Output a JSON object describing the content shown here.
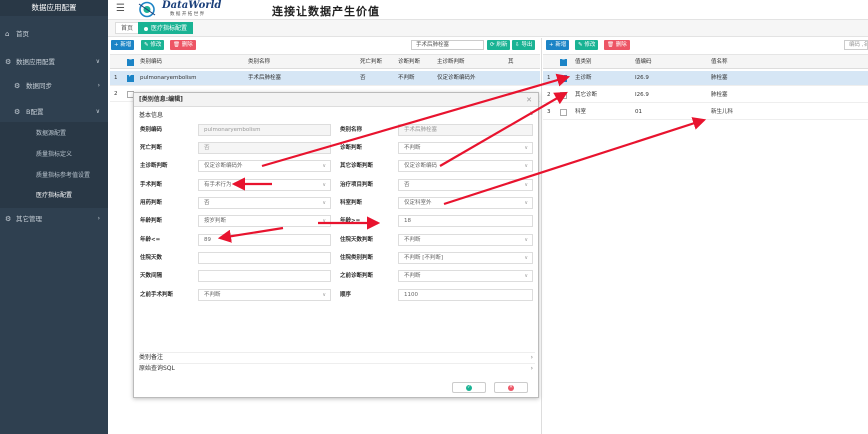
{
  "sidebar": {
    "title": "数据应用配置",
    "items": [
      {
        "label": "首页"
      },
      {
        "label": "数据应用配置"
      },
      {
        "label": "数据同步"
      },
      {
        "label": "B配置"
      },
      {
        "label": "其它管理"
      }
    ],
    "subitems": [
      {
        "label": "数据源配置"
      },
      {
        "label": "质量指标定义"
      },
      {
        "label": "质量指标参考值设置"
      },
      {
        "label": "医疗指标配置"
      }
    ]
  },
  "header": {
    "logo_text": "DataWorld",
    "logo_sub": "数 据 开 拓 世 界",
    "slogan": "连接让数据产生价值"
  },
  "tabs": [
    {
      "label": "首页"
    },
    {
      "label": "医疗指标配置"
    }
  ],
  "left_toolbar": {
    "add": "+ 新增",
    "edit": "✎ 修改",
    "delete": "🗑 删除",
    "search_value": "手术后肺栓塞",
    "refresh": "⟳ 刷新",
    "export": "⇩ 导出"
  },
  "left_table": {
    "headers": [
      "类别编码",
      "类别名称",
      "死亡判断",
      "诊断判断",
      "主诊断判断",
      "其"
    ],
    "rows": [
      {
        "num": "1",
        "code": "pulmonaryembolism",
        "name": "手术后肺栓塞",
        "death": "否",
        "diag": "不判断",
        "main": "仅定诊断编码外"
      },
      {
        "num": "2",
        "code": "",
        "name": "",
        "death": "",
        "diag": "",
        "main": ""
      }
    ]
  },
  "right_toolbar": {
    "add": "+ 新增",
    "edit": "✎ 修改",
    "delete": "🗑 删除",
    "search_value": "编码 ,名"
  },
  "right_table": {
    "headers": [
      "值类别",
      "值编码",
      "值名称"
    ],
    "rows": [
      {
        "num": "1",
        "type": "主诊断",
        "code": "I26.9",
        "name": "肺栓塞"
      },
      {
        "num": "2",
        "type": "其它诊断",
        "code": "I26.9",
        "name": "肺栓塞"
      },
      {
        "num": "3",
        "type": "科室",
        "code": "01",
        "name": "新生儿科"
      }
    ]
  },
  "modal": {
    "title": "[类别信息:编辑]",
    "section": "基本信息",
    "fields": {
      "code_label": "类别编码",
      "code_value": "pulmonaryembolism",
      "name_label": "类别名称",
      "name_value": "手术后肺栓塞",
      "death_label": "死亡判断",
      "death_value": "否",
      "diag_label": "诊断判断",
      "diag_value": "不判断",
      "main_diag_label": "主诊断判断",
      "main_diag_value": "仅定诊断编码外",
      "other_diag_label": "其它诊断判断",
      "other_diag_value": "仅定诊断编码",
      "surgery_label": "手术判断",
      "surgery_value": "有手术行为",
      "treat_label": "治疗项目判断",
      "treat_value": "否",
      "drug_label": "用药判断",
      "drug_value": "否",
      "dept_label": "科室判断",
      "dept_value": "仅定科室外",
      "age_label": "年龄判断",
      "age_value": "按岁判断",
      "age_ge_label": "年龄>=",
      "age_ge_value": "18",
      "age_le_label": "年龄<=",
      "age_le_value": "89",
      "stay_label": "住院天数判断",
      "stay_value": "不判断",
      "stay_days_label": "住院天数",
      "stay_days_value": "",
      "stay_cat_label": "住院类别判断",
      "stay_cat_value": "不判断 [不判断]",
      "interval_label": "天数间隔",
      "interval_value": "",
      "prev_diag_label": "之前诊断判断",
      "prev_diag_value": "不判断",
      "prev_surg_label": "之前手术判断",
      "prev_surg_value": "不判断",
      "order_label": "顺序",
      "order_value": "1100"
    },
    "remark_label": "类别备注",
    "sql_label": "原始查询SQL"
  },
  "colors": {
    "sidebar": "#2f4050",
    "accent_green": "#1ab394",
    "accent_blue": "#1c84c6",
    "danger_red": "#ed5565",
    "arrow_red": "#e8132e"
  }
}
